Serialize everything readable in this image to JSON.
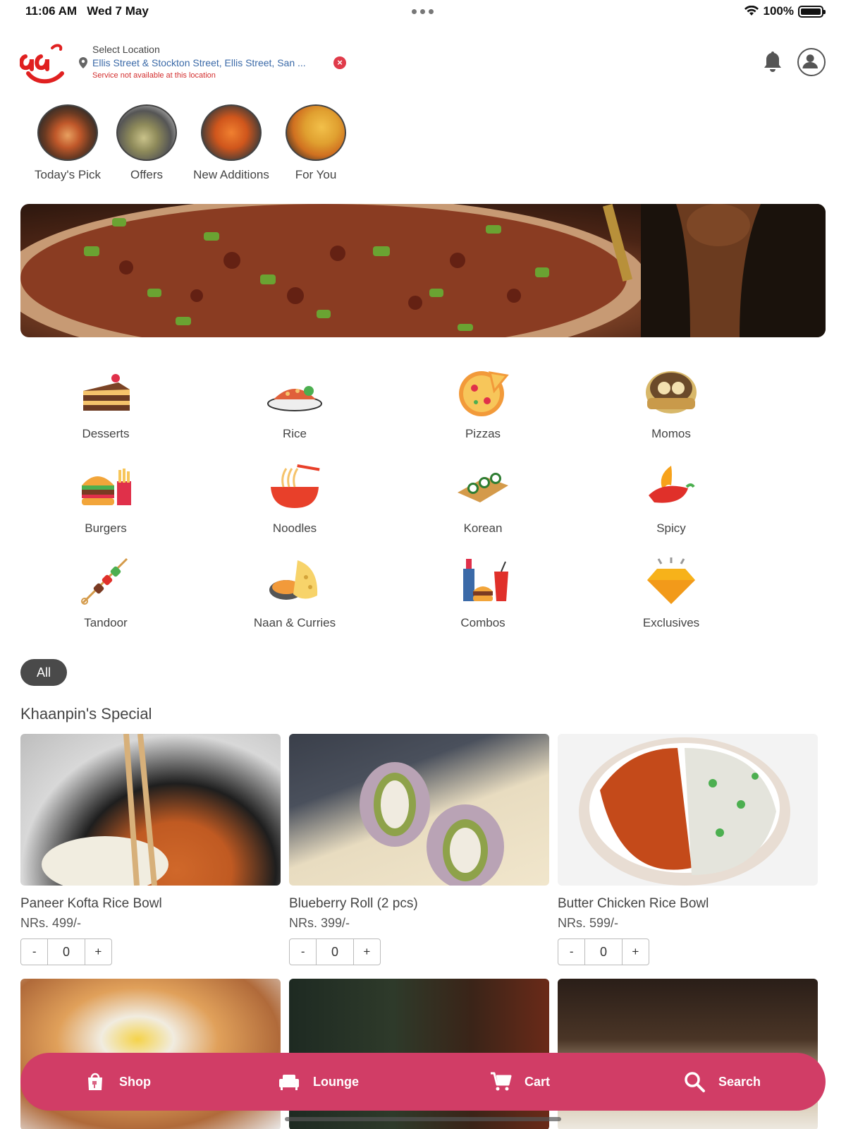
{
  "status": {
    "time": "11:06 AM",
    "date": "Wed 7 May",
    "battery": "100%",
    "battery_level": 1.0
  },
  "header": {
    "location_label": "Select Location",
    "location_address": "Ellis Street & Stockton Street, Ellis Street, San ...",
    "location_error": "Service not available at this location"
  },
  "stories": [
    {
      "label": "Today's Pick"
    },
    {
      "label": "Offers"
    },
    {
      "label": "New Additions"
    },
    {
      "label": "For You"
    }
  ],
  "categories": [
    {
      "label": "Desserts",
      "icon": "cake-icon"
    },
    {
      "label": "Rice",
      "icon": "rice-icon"
    },
    {
      "label": "Pizzas",
      "icon": "pizza-icon"
    },
    {
      "label": "Momos",
      "icon": "momo-icon"
    },
    {
      "label": "Burgers",
      "icon": "burger-icon"
    },
    {
      "label": "Noodles",
      "icon": "noodles-icon"
    },
    {
      "label": "Korean",
      "icon": "sushi-icon"
    },
    {
      "label": "Spicy",
      "icon": "chili-icon"
    },
    {
      "label": "Tandoor",
      "icon": "skewer-icon"
    },
    {
      "label": "Naan & Curries",
      "icon": "naan-icon"
    },
    {
      "label": "Combos",
      "icon": "combo-icon"
    },
    {
      "label": "Exclusives",
      "icon": "diamond-icon"
    }
  ],
  "filter": {
    "chip": "All"
  },
  "section_title": "Khaanpin's Special",
  "products": [
    {
      "name": "Paneer Kofta Rice Bowl",
      "price": "NRs. 499/-",
      "qty": "0",
      "minus": "-",
      "plus": "+"
    },
    {
      "name": "Blueberry Roll (2 pcs)",
      "price": "NRs. 399/-",
      "qty": "0",
      "minus": "-",
      "plus": "+"
    },
    {
      "name": "Butter Chicken Rice Bowl",
      "price": "NRs. 599/-",
      "qty": "0",
      "minus": "-",
      "plus": "+"
    }
  ],
  "nav": {
    "shop": "Shop",
    "lounge": "Lounge",
    "cart": "Cart",
    "search": "Search"
  },
  "colors": {
    "brand": "#d13d66",
    "error": "#d32f2f",
    "link": "#3b6aa8"
  }
}
